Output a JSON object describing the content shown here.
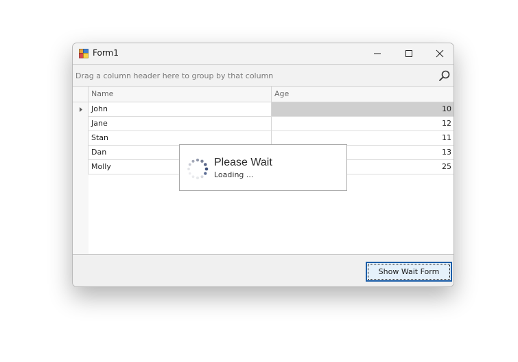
{
  "window": {
    "title": "Form1",
    "icons": {
      "app": "form-app-icon",
      "minimize": "minimize-icon",
      "maximize": "maximize-icon",
      "close": "close-icon"
    }
  },
  "grid": {
    "group_panel_text": "Drag a column header here to group by that column",
    "find_icon": "search-icon",
    "columns": [
      "Name",
      "Age"
    ],
    "rows": [
      {
        "name": "John",
        "age": "10",
        "focused": true
      },
      {
        "name": "Jane",
        "age": "12"
      },
      {
        "name": "Stan",
        "age": "11"
      },
      {
        "name": "Dan",
        "age": "13"
      },
      {
        "name": "Molly",
        "age": "25"
      }
    ]
  },
  "wait_form": {
    "caption": "Please Wait",
    "description": "Loading ...",
    "icon": "loading-spinner-icon"
  },
  "footer": {
    "button_label": "Show Wait Form"
  },
  "colors": {
    "focused_cell": "#cfcfcf",
    "button_border": "#1c5ea8",
    "button_fill": "#e5f1fb"
  }
}
